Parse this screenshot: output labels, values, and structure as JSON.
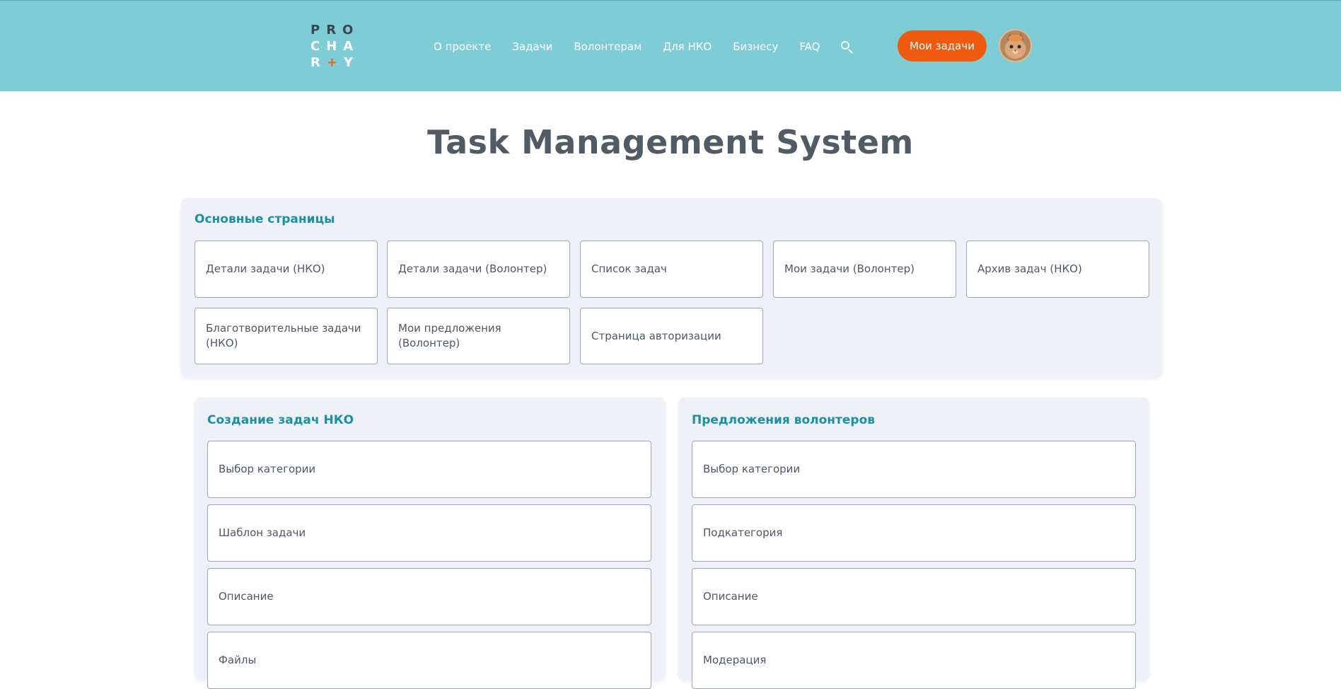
{
  "header": {
    "logo": {
      "row1": "PRO",
      "row2": "CHA",
      "row3_r": "R",
      "row3_plus": "+",
      "row3_y": "Y"
    },
    "nav": [
      "О проекте",
      "Задачи",
      "Волонтерам",
      "Для НКО",
      "Бизнесу",
      "FAQ"
    ],
    "search_icon": "search-icon",
    "my_tasks_label": "Мои задачи",
    "avatar_icon": "user-avatar"
  },
  "page": {
    "title": "Task Management System"
  },
  "main_pages": {
    "title": "Основные страницы",
    "items": [
      "Детали задачи (НКО)",
      "Детали задачи (Волонтер)",
      "Список задач",
      "Мои задачи (Волонтер)",
      "Архив задач (НКО)",
      "Благотворительные задачи (НКО)",
      "Мои предложения (Волонтер)",
      "Страница авторизации"
    ]
  },
  "nko_tasks": {
    "title": "Создание задач НКО",
    "items": [
      "Выбор категории",
      "Шаблон задачи",
      "Описание",
      "Файлы"
    ]
  },
  "volunteer_offers": {
    "title": "Предложения волонтеров",
    "items": [
      "Выбор категории",
      "Подкатегория",
      "Описание",
      "Модерация"
    ]
  },
  "colors": {
    "header_bg": "#7ecdd6",
    "accent_button": "#ee5b10",
    "section_title": "#1b8fa6",
    "panel_bg": "#eef2f8"
  }
}
